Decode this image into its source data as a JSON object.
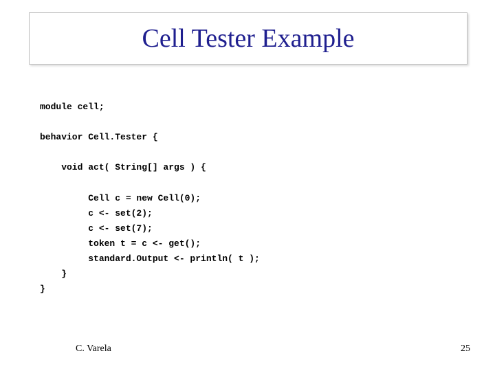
{
  "title": "Cell Tester Example",
  "code": "module cell;\n\nbehavior Cell.Tester {\n\n    void act( String[] args ) {\n\n         Cell c = new Cell(0);\n         c <- set(2);\n         c <- set(7);\n         token t = c <- get();\n         standard.Output <- println( t );\n    }\n}",
  "footer_author": "C. Varela",
  "footer_page": "25"
}
